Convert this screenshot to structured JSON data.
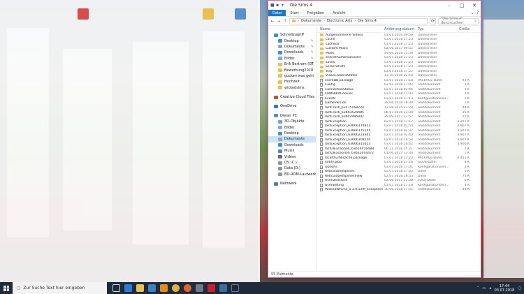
{
  "window": {
    "title": "Die Sims 4",
    "tabs": [
      "Datei",
      "Start",
      "Freigeben",
      "Ansicht"
    ],
    "breadcrumb": [
      "Dokumente",
      "Electronic Arts",
      "Die Sims 4"
    ],
    "search_placeholder": "\"Die Sims 4\" durchsuchen",
    "status": "55 Elemente"
  },
  "columns": {
    "name": "Name",
    "date": "Änderungsdatum",
    "type": "Typ",
    "size": "Größe"
  },
  "nav": [
    {
      "label": "Schnellzugriff",
      "icon": "star-icon",
      "level": 1,
      "color": "#3f8bd6"
    },
    {
      "label": "Desktop",
      "icon": "desktop-icon",
      "level": 2,
      "color": "#4a90d9",
      "pin": true
    },
    {
      "label": "Dokumente",
      "icon": "document-icon",
      "level": 2,
      "color": "#9aa7b5",
      "pin": true
    },
    {
      "label": "Downloads",
      "icon": "download-icon",
      "level": 2,
      "color": "#3f8bd6",
      "pin": true
    },
    {
      "label": "Bilder",
      "icon": "pictures-icon",
      "level": 2,
      "color": "#7ab0e0",
      "pin": true
    },
    {
      "label": "Erik Bertram (GT",
      "icon": "folder-icon",
      "level": 2,
      "color": "#e9c153",
      "pin": true
    },
    {
      "label": "Bewerbung2018",
      "icon": "folder-icon",
      "level": 2,
      "color": "#e9c153"
    },
    {
      "label": "gucken was geht",
      "icon": "folder-icon",
      "level": 2,
      "color": "#e9c153"
    },
    {
      "label": "Hochzeit",
      "icon": "folder-icon",
      "level": 2,
      "color": "#e9c153"
    },
    {
      "label": "wickedsims",
      "icon": "folder-icon",
      "level": 2,
      "color": "#e9c153"
    },
    {
      "label": "Creative Cloud Files",
      "icon": "cloud-icon",
      "level": 1,
      "color": "#d24b2e",
      "gap": true
    },
    {
      "label": "OneDrive",
      "icon": "onedrive-icon",
      "level": 1,
      "color": "#2f7bd5",
      "gap": true
    },
    {
      "label": "Dieser PC",
      "icon": "computer-icon",
      "level": 1,
      "color": "#5b8fc7",
      "gap": true
    },
    {
      "label": "3D-Objekte",
      "icon": "cube-icon",
      "level": 2,
      "color": "#6aa6de"
    },
    {
      "label": "Bilder",
      "icon": "pictures-icon",
      "level": 2,
      "color": "#7ab0e0"
    },
    {
      "label": "Desktop",
      "icon": "desktop-icon",
      "level": 2,
      "color": "#4a90d9"
    },
    {
      "label": "Dokumente",
      "icon": "document-icon",
      "level": 2,
      "color": "#9aa7b5",
      "selected": true
    },
    {
      "label": "Downloads",
      "icon": "download-icon",
      "level": 2,
      "color": "#3f8bd6"
    },
    {
      "label": "Musik",
      "icon": "music-icon",
      "level": 2,
      "color": "#3f8bd6"
    },
    {
      "label": "Videos",
      "icon": "video-icon",
      "level": 2,
      "color": "#5d6f86"
    },
    {
      "label": "OS (C:)",
      "icon": "drive-icon",
      "level": 2,
      "color": "#8a97a6"
    },
    {
      "label": "Data (D:)",
      "icon": "drive-icon",
      "level": 2,
      "color": "#8a97a6"
    },
    {
      "label": "BD-ROM-Laufwerk",
      "icon": "disc-icon",
      "level": 2,
      "color": "#8a97a6"
    },
    {
      "label": "Netzwerk",
      "icon": "network-icon",
      "level": 1,
      "color": "#4e7fb8",
      "gap": true
    }
  ],
  "files": [
    {
      "name": "Aufgenommene Videos",
      "date": "01.01.2016 09:58",
      "type": "Dateiordner",
      "size": "",
      "kind": "folder"
    },
    {
      "name": "cache",
      "date": "03.07.2018 17:23",
      "type": "Dateiordner",
      "size": "",
      "kind": "folder"
    },
    {
      "name": "cachestr",
      "date": "03.07.2018 17:23",
      "type": "Dateiordner",
      "size": "",
      "kind": "folder"
    },
    {
      "name": "Custom Music",
      "date": "02.06.2017 00:52",
      "type": "Dateiordner",
      "size": "",
      "kind": "folder"
    },
    {
      "name": "Mods",
      "date": "29.06.2018 15:56",
      "type": "Dateiordner",
      "size": "",
      "kind": "folder"
    },
    {
      "name": "onlinethumbnailcache",
      "date": "03.07.2018 17:23",
      "type": "Dateiordner",
      "size": "",
      "kind": "folder"
    },
    {
      "name": "saves",
      "date": "03.07.2018 17:23",
      "type": "Dateiordner",
      "size": "",
      "kind": "folder"
    },
    {
      "name": "Screenshots",
      "date": "03.07.2018 17:23",
      "type": "Dateiordner",
      "size": "",
      "kind": "folder"
    },
    {
      "name": "Tray",
      "date": "03.07.2018 17:22",
      "type": "Dateiordner",
      "size": "",
      "kind": "folder"
    },
    {
      "name": "VideoCameraStates",
      "date": "13.10.2016 22:18",
      "type": "Dateiordner",
      "size": "",
      "kind": "folder"
    },
    {
      "name": "clientDB.package",
      "date": "03.07.2018 17:18",
      "type": "PACKAGE-Datei",
      "size": "93 K",
      "kind": "file"
    },
    {
      "name": "Config",
      "date": "03.07.2018 17:02",
      "type": "Textdokument",
      "size": "3 K",
      "kind": "file"
    },
    {
      "name": "ConnectionStatus",
      "date": "02.07.2018 02:46",
      "type": "Textdokument",
      "size": "1 K",
      "kind": "file"
    },
    {
      "name": "EAWebKitCookies",
      "date": "03.07.2018 17:03",
      "type": "Textdokument",
      "size": "1 K",
      "kind": "file"
    },
    {
      "name": "Events",
      "date": "03.07.2018 17:13",
      "type": "Konfigurationsein...",
      "size": "1 K",
      "kind": "file"
    },
    {
      "name": "GameVersion",
      "date": "28.06.2018 18:30",
      "type": "Textdokument",
      "size": "1 K",
      "kind": "file"
    },
    {
      "name": "lastCrash_63575168224",
      "date": "12.08.2015 21:20",
      "type": "Textdokument",
      "size": "44 K",
      "kind": "file"
    },
    {
      "name": "lastCrash_63603524485",
      "date": "06.07.2016 23:39",
      "type": "Textdokument",
      "size": "36 K",
      "kind": "file"
    },
    {
      "name": "lastCrash_63642995902",
      "date": "29.09.2017 11:57",
      "type": "Textdokument",
      "size": "23 K",
      "kind": "file"
    },
    {
      "name": "lastException",
      "date": "02.07.2018 17:17",
      "type": "Textdokument",
      "size": "3.297 K",
      "kind": "file"
    },
    {
      "name": "lastException_63666174853",
      "date": "02.07.2018 01:54",
      "type": "Textdokument",
      "size": "3.907 K",
      "kind": "file"
    },
    {
      "name": "lastException_63666175145",
      "date": "02.07.2018 02:37",
      "type": "Textdokument",
      "size": "3.907 K",
      "kind": "file"
    },
    {
      "name": "lastException_63666223341",
      "date": "02.07.2018 02:43",
      "type": "Textdokument",
      "size": "3.907 K",
      "kind": "file"
    },
    {
      "name": "lastException_63666308550",
      "date": "02.07.2018 16:54",
      "type": "Textdokument",
      "size": "3.907 K",
      "kind": "file"
    },
    {
      "name": "lastException_63666313013",
      "date": "03.07.2018 16:42",
      "type": "Textdokument",
      "size": "3.906 K",
      "kind": "file"
    },
    {
      "name": "lastUIException_63614416488",
      "date": "06.11.2016 15:21",
      "type": "Textdokument",
      "size": "1 K",
      "kind": "file"
    },
    {
      "name": "lastUIException_63632044472",
      "date": "01.06.2017 13:34",
      "type": "Textdokument",
      "size": "1 K",
      "kind": "file"
    },
    {
      "name": "localthumbcache.package",
      "date": "03.07.2018 17:23",
      "type": "PACKAGE-Datei",
      "size": "3.451 K",
      "kind": "file"
    },
    {
      "name": "notify.glob",
      "date": "03.07.2018 17:16",
      "type": "GLOB-Datei",
      "size": "4 K",
      "kind": "file"
    },
    {
      "name": "Options",
      "date": "03.07.2018 17:01",
      "type": "Konfigurationsein...",
      "size": "2 K",
      "kind": "file"
    },
    {
      "name": "ReticulatedSplines",
      "date": "03.07.2018 17:03",
      "type": "Datei",
      "size": "1 K",
      "kind": "file"
    },
    {
      "name": "ReticulatedSplinesView",
      "date": "02.07.2018 16:33",
      "type": "Datei",
      "size": "71 K",
      "kind": "file"
    },
    {
      "name": "UserData.lock",
      "date": "02.06.2017 12:38",
      "type": "LOCK-Datei",
      "size": "0 K",
      "kind": "file"
    },
    {
      "name": "UserSetting",
      "date": "03.07.2018 17:18",
      "type": "Konfigurationsein...",
      "size": "3 K",
      "kind": "file"
    },
    {
      "name": "WickedWhims_5.3.4.129f_Exception",
      "date": "30.06.2018 17:51",
      "type": "Textdokument",
      "size": "44 K",
      "kind": "file"
    }
  ],
  "taskbar": {
    "search_placeholder": "Zur Suche Text hier eingeben",
    "time": "17:44",
    "date": "03.07.2018"
  },
  "colors": {
    "accent": "#1979ca",
    "folder": "#e9c153",
    "selection": "#cce4f7",
    "taskbar": "#1f2b3a"
  }
}
